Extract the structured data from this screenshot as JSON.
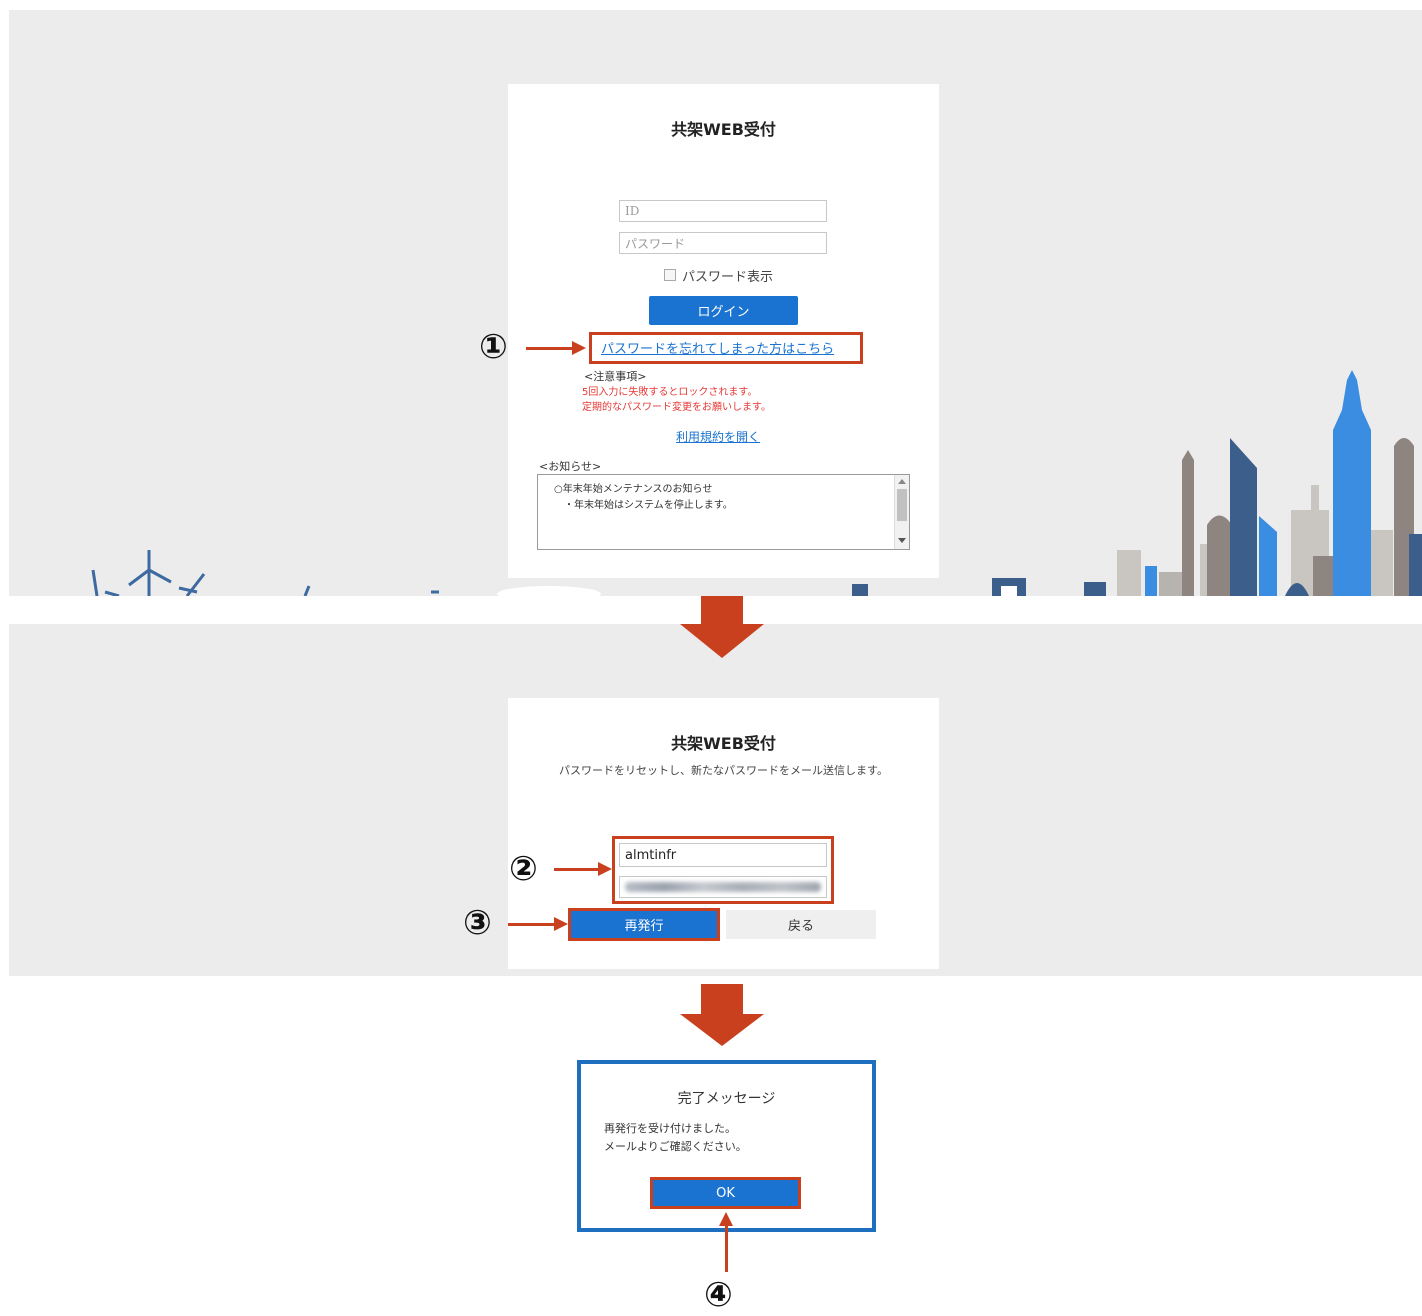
{
  "login": {
    "title": "共架WEB受付",
    "id_placeholder": "ID",
    "password_placeholder": "パスワード",
    "show_password_label": "パスワード表示",
    "login_button": "ログイン",
    "forgot_link": "パスワードを忘れてしまった方はこちら",
    "caution_heading": "<注意事項>",
    "caution_line1": "5回入力に失敗するとロックされます。",
    "caution_line2": "定期的なパスワード変更をお願いします。",
    "terms_link": "利用規約を開く",
    "notice_heading": "<お知らせ>",
    "notice_line1": "○年末年始メンテナンスのお知らせ",
    "notice_line2": "・年末年始はシステムを停止します。"
  },
  "reset": {
    "title": "共架WEB受付",
    "description": "パスワードをリセットし、新たなパスワードをメール送信します。",
    "id_value": "almtinfr",
    "reissue_button": "再発行",
    "back_button": "戻る"
  },
  "dialog": {
    "title": "完了メッセージ",
    "line1": "再発行を受け付けました。",
    "line2": "メールよりご確認ください。",
    "ok_button": "OK"
  },
  "callouts": {
    "c1": "①",
    "c2": "②",
    "c3": "③",
    "c4": "④"
  },
  "colors": {
    "accent_blue": "#1a73d0",
    "highlight_red": "#c9401e",
    "panel_gray": "#ececec"
  }
}
